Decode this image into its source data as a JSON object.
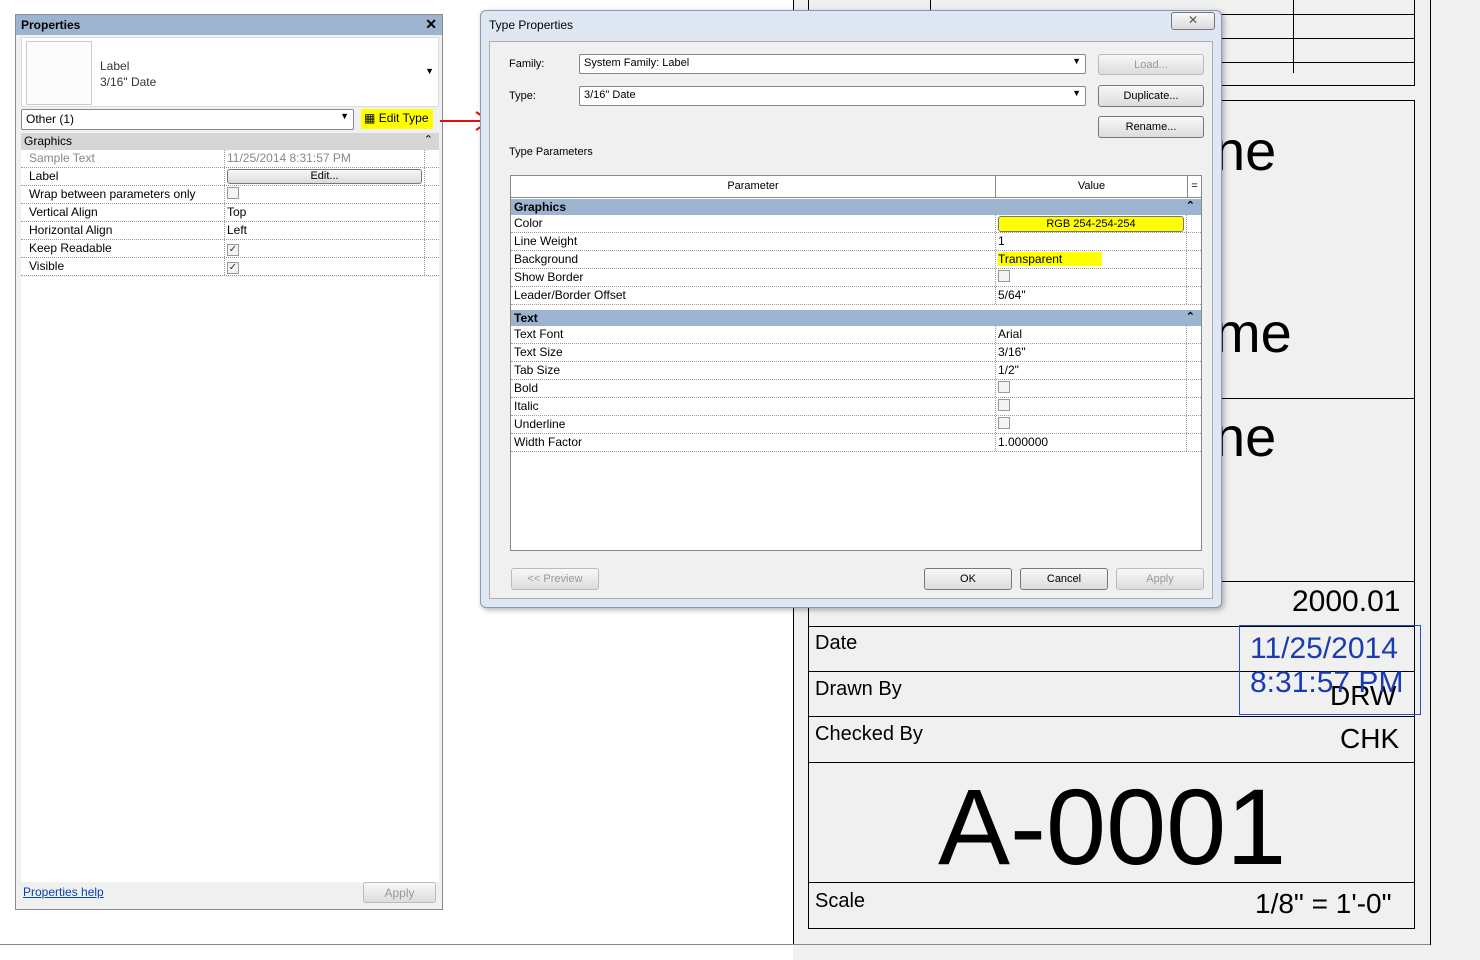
{
  "properties": {
    "title": "Properties",
    "type_family": "Label",
    "type_name": "3/16\" Date",
    "instance_filter": "Other (1)",
    "edit_type_label": "Edit Type",
    "group": "Graphics",
    "rows": [
      {
        "name": "Sample Text",
        "value": "11/25/2014 8:31:57 PM"
      },
      {
        "name": "Label",
        "value": "Edit..."
      },
      {
        "name": "Wrap between parameters only",
        "checked": false
      },
      {
        "name": "Vertical Align",
        "value": "Top"
      },
      {
        "name": "Horizontal Align",
        "value": "Left"
      },
      {
        "name": "Keep Readable",
        "checked": true
      },
      {
        "name": "Visible",
        "checked": true
      }
    ],
    "help_link": "Properties help",
    "apply_label": "Apply"
  },
  "dialog": {
    "title": "Type Properties",
    "family_label": "Family:",
    "family_value": "System Family: Label",
    "type_label": "Type:",
    "type_value": "3/16\" Date",
    "load_label": "Load...",
    "duplicate_label": "Duplicate...",
    "rename_label": "Rename...",
    "section_label": "Type Parameters",
    "col_parameter": "Parameter",
    "col_value": "Value",
    "groups": [
      {
        "name": "Graphics",
        "rows": [
          {
            "name": "Color",
            "value": "RGB 254-254-254"
          },
          {
            "name": "Line Weight",
            "value": "1"
          },
          {
            "name": "Background",
            "value": "Transparent"
          },
          {
            "name": "Show Border",
            "checked": false
          },
          {
            "name": "Leader/Border Offset",
            "value": "5/64\""
          }
        ]
      },
      {
        "name": "Text",
        "rows": [
          {
            "name": "Text Font",
            "value": "Arial"
          },
          {
            "name": "Text Size",
            "value": "3/16\""
          },
          {
            "name": "Tab Size",
            "value": "1/2\""
          },
          {
            "name": "Bold",
            "checked": false
          },
          {
            "name": "Italic",
            "checked": false
          },
          {
            "name": "Underline",
            "checked": false
          },
          {
            "name": "Width Factor",
            "value": "1.000000"
          }
        ]
      }
    ],
    "preview_label": "<< Preview",
    "ok_label": "OK",
    "cancel_label": "Cancel",
    "apply_label": "Apply"
  },
  "sheet": {
    "partial_texts": [
      "ne",
      "me",
      "ne"
    ],
    "project_number": "2000.01",
    "date_label": "Date",
    "date_value_line1": "11/25/2014",
    "date_value_line2": "8:31:57 PM",
    "drawn_by_label": "Drawn By",
    "drawn_by_value": "DRW",
    "checked_by_label": "Checked By",
    "checked_by_value": "CHK",
    "sheet_number": "A-0001",
    "scale_label": "Scale",
    "scale_value": "1/8\" = 1'-0\""
  }
}
